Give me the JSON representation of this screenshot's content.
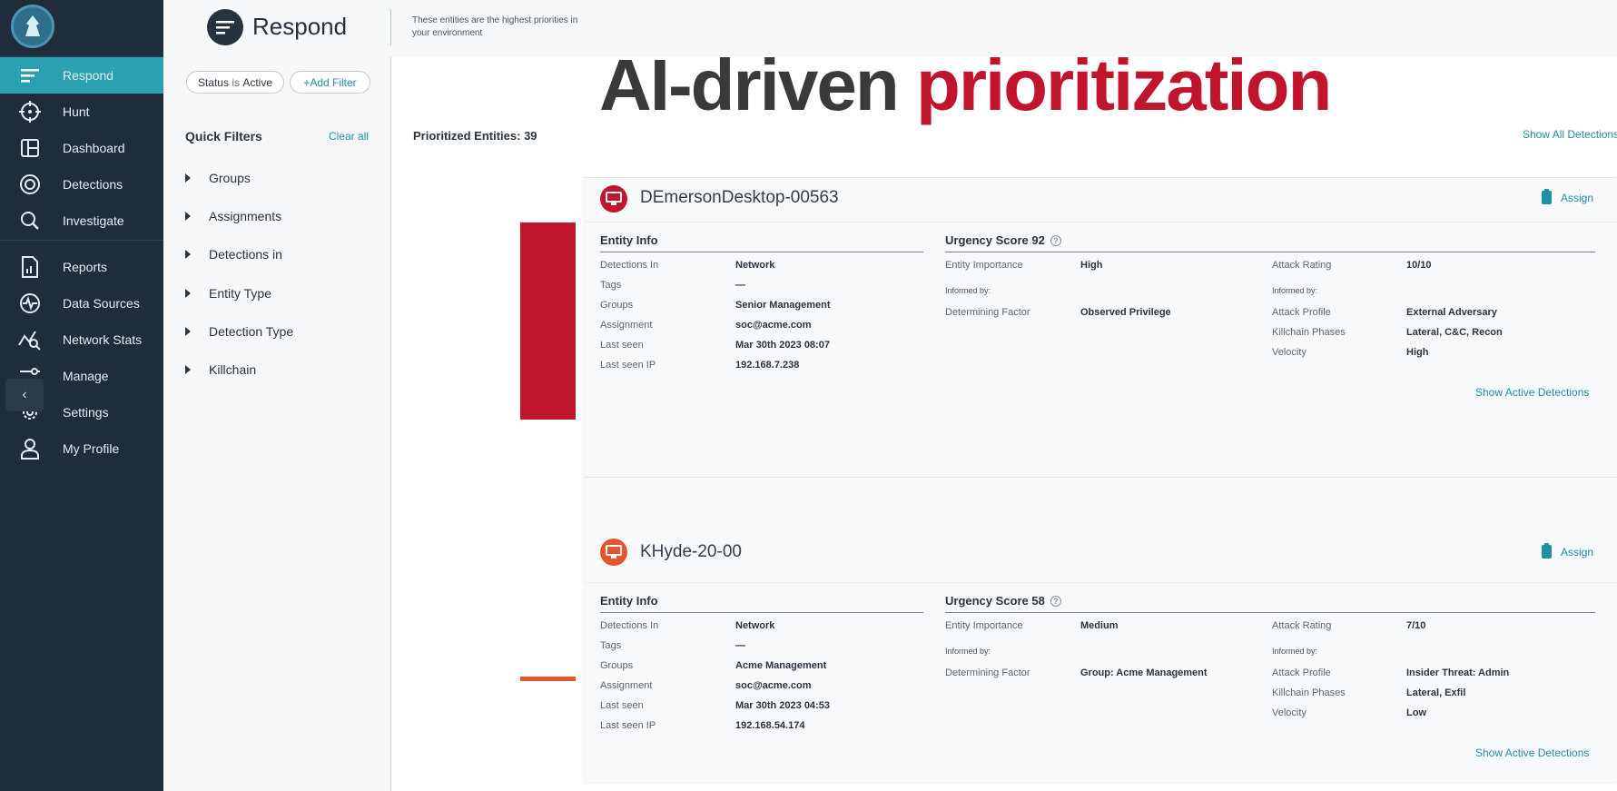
{
  "sidebar": {
    "items": [
      {
        "label": "Respond",
        "icon": "respond-icon"
      },
      {
        "label": "Hunt",
        "icon": "crosshair-icon"
      },
      {
        "label": "Dashboard",
        "icon": "dashboard-icon"
      },
      {
        "label": "Detections",
        "icon": "target-icon"
      },
      {
        "label": "Investigate",
        "icon": "search-icon"
      },
      {
        "label": "Reports",
        "icon": "report-icon"
      },
      {
        "label": "Data Sources",
        "icon": "pulse-icon"
      },
      {
        "label": "Network Stats",
        "icon": "chart-search-icon"
      },
      {
        "label": "Manage",
        "icon": "sliders-icon"
      },
      {
        "label": "Settings",
        "icon": "gear-icon"
      },
      {
        "label": "My Profile",
        "icon": "user-icon"
      }
    ],
    "collapse_glyph": "‹"
  },
  "header": {
    "title": "Respond",
    "description": "These entities are the highest priorities in your environment"
  },
  "overlay": {
    "word1": "AI-driven",
    "word2": "prioritization"
  },
  "filters": {
    "status_pill_key": "Status",
    "status_pill_op": "is",
    "status_pill_value": "Active",
    "add_filter": "+Add Filter",
    "quick_filters_title": "Quick Filters",
    "clear_all": "Clear all",
    "items": [
      "Groups",
      "Assignments",
      "Detections in",
      "Entity Type",
      "Detection Type",
      "Killchain"
    ]
  },
  "main": {
    "prioritized_label": "Prioritized Entities: 39",
    "show_all": "Show All Detections"
  },
  "entities": [
    {
      "name": "DEmersonDesktop-00563",
      "urgency_color": "#c0152c",
      "urgency_score": 92,
      "assign": "Assign",
      "entity_info_title": "Entity Info",
      "urgency_title": "Urgency Score 92",
      "info": [
        {
          "k": "Detections In",
          "v": "Network"
        },
        {
          "k": "Tags",
          "v": "—"
        },
        {
          "k": "Groups",
          "v": "Senior Management"
        },
        {
          "k": "Assignment",
          "v": "soc@acme.com"
        },
        {
          "k": "Last seen",
          "v": "Mar 30th 2023 08:07"
        },
        {
          "k": "Last seen IP",
          "v": "192.168.7.238"
        }
      ],
      "entity_importance": {
        "k": "Entity Importance",
        "v": "High"
      },
      "informed_by_left": "Informed by:",
      "determining_factor": {
        "k": "Determining Factor",
        "v": "Observed Privilege"
      },
      "attack_rating": {
        "k": "Attack Rating",
        "v": "10/10"
      },
      "informed_by_right": "Informed by:",
      "attack": [
        {
          "k": "Attack Profile",
          "v": "External Adversary"
        },
        {
          "k": "Killchain Phases",
          "v": "Lateral, C&C, Recon"
        },
        {
          "k": "Velocity",
          "v": "High"
        }
      ],
      "show_active": "Show Active Detections"
    },
    {
      "name": "KHyde-20-00",
      "urgency_color": "#e2552e",
      "urgency_score": 58,
      "assign": "Assign",
      "entity_info_title": "Entity Info",
      "urgency_title": "Urgency Score 58",
      "info": [
        {
          "k": "Detections In",
          "v": "Network"
        },
        {
          "k": "Tags",
          "v": "—"
        },
        {
          "k": "Groups",
          "v": "Acme Management"
        },
        {
          "k": "Assignment",
          "v": "soc@acme.com"
        },
        {
          "k": "Last seen",
          "v": "Mar 30th 2023 04:53"
        },
        {
          "k": "Last seen IP",
          "v": "192.168.54.174"
        }
      ],
      "entity_importance": {
        "k": "Entity Importance",
        "v": "Medium"
      },
      "informed_by_left": "Informed by:",
      "determining_factor": {
        "k": "Determining Factor",
        "v": "Group: Acme Management"
      },
      "attack_rating": {
        "k": "Attack Rating",
        "v": "7/10"
      },
      "informed_by_right": "Informed by:",
      "attack": [
        {
          "k": "Attack Profile",
          "v": "Insider Threat: Admin"
        },
        {
          "k": "Killchain Phases",
          "v": "Lateral, Exfil"
        },
        {
          "k": "Velocity",
          "v": "Low"
        }
      ],
      "show_active": "Show Active Detections"
    }
  ]
}
